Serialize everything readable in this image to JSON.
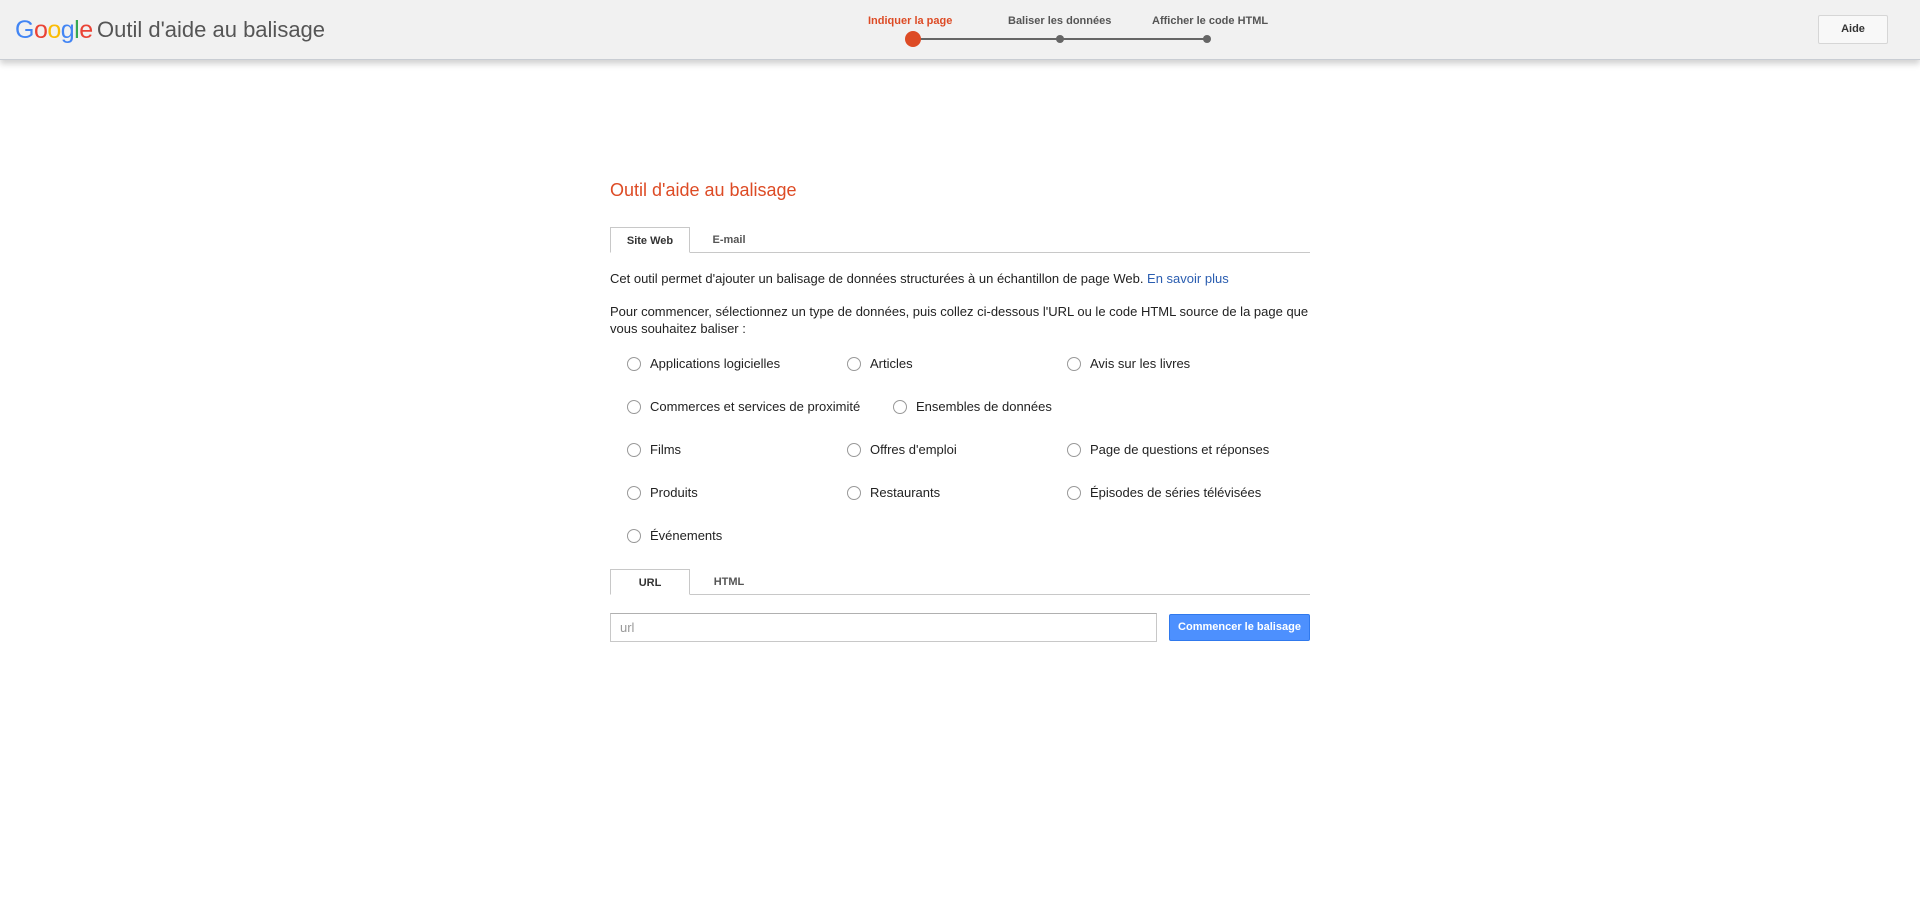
{
  "header": {
    "logo_letters": [
      "G",
      "o",
      "o",
      "g",
      "l",
      "e"
    ],
    "app_title": "Outil d'aide au balisage",
    "help_label": "Aide",
    "steps": [
      {
        "label": "Indiquer la page",
        "active": true
      },
      {
        "label": "Baliser les données",
        "active": false
      },
      {
        "label": "Afficher le code HTML",
        "active": false
      }
    ]
  },
  "main": {
    "title": "Outil d'aide au balisage",
    "source_tabs": [
      {
        "label": "Site Web",
        "selected": true
      },
      {
        "label": "E-mail",
        "selected": false
      }
    ],
    "intro_text": "Cet outil permet d'ajouter un balisage de données structurées à un échantillon de page Web. ",
    "learn_more_label": "En savoir plus",
    "instructions": "Pour commencer, sélectionnez un type de données, puis collez ci-dessous l'URL ou le code HTML source de la page que vous souhaitez baliser :",
    "data_types": [
      "Applications logicielles",
      "Articles",
      "Avis sur les livres",
      "Commerces et services de proximité",
      "Ensembles de données",
      "Films",
      "Offres d'emploi",
      "Page de questions et réponses",
      "Produits",
      "Restaurants",
      "‎Épisodes de séries télévisées",
      "Événements"
    ],
    "input_tabs": [
      {
        "label": "URL",
        "selected": true
      },
      {
        "label": "HTML",
        "selected": false
      }
    ],
    "url_placeholder": "url",
    "start_button_label": "Commencer le balisage"
  },
  "colors": {
    "accent": "#dd4b25",
    "primary_button": "#4d90fe",
    "link": "#2a5db0",
    "header_bg": "#f1f1f1"
  }
}
